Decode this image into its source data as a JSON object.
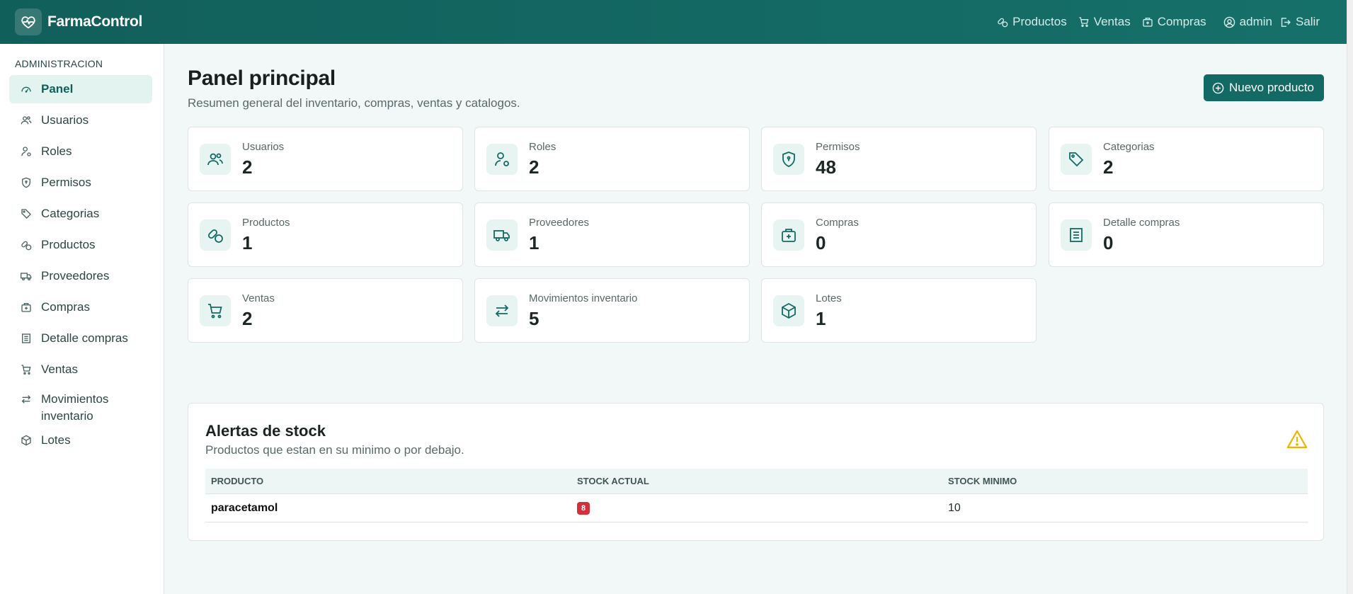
{
  "app": {
    "name": "FarmaControl",
    "logo_icon": "heart-pulse-icon"
  },
  "topnav": {
    "items": [
      {
        "label": "Productos",
        "icon": "pills-icon"
      },
      {
        "label": "Ventas",
        "icon": "cart-icon"
      },
      {
        "label": "Compras",
        "icon": "medkit-bag-icon"
      }
    ],
    "user": {
      "label": "admin",
      "icon": "user-circle-icon"
    },
    "logout": {
      "label": "Salir",
      "icon": "logout-icon"
    }
  },
  "sidebar": {
    "heading": "ADMINISTRACION",
    "items": [
      {
        "label": "Panel",
        "icon": "speedometer-icon",
        "active": true
      },
      {
        "label": "Usuarios",
        "icon": "users-icon"
      },
      {
        "label": "Roles",
        "icon": "user-gear-icon"
      },
      {
        "label": "Permisos",
        "icon": "shield-icon"
      },
      {
        "label": "Categorias",
        "icon": "tags-icon"
      },
      {
        "label": "Productos",
        "icon": "pills-icon"
      },
      {
        "label": "Proveedores",
        "icon": "truck-icon"
      },
      {
        "label": "Compras",
        "icon": "medkit-bag-icon"
      },
      {
        "label": "Detalle compras",
        "icon": "receipt-icon"
      },
      {
        "label": "Ventas",
        "icon": "cart-icon"
      },
      {
        "label": "Movimientos inventario",
        "icon": "arrows-left-right-icon"
      },
      {
        "label": "Lotes",
        "icon": "box-icon"
      }
    ]
  },
  "header": {
    "title": "Panel principal",
    "subtitle": "Resumen general del inventario, compras, ventas y catalogos.",
    "new_button": "Nuevo producto"
  },
  "stats": [
    {
      "label": "Usuarios",
      "value": "2"
    },
    {
      "label": "Roles",
      "value": "2"
    },
    {
      "label": "Permisos",
      "value": "48"
    },
    {
      "label": "Categorias",
      "value": "2"
    },
    {
      "label": "Productos",
      "value": "1"
    },
    {
      "label": "Proveedores",
      "value": "1"
    },
    {
      "label": "Compras",
      "value": "0"
    },
    {
      "label": "Detalle compras",
      "value": "0"
    },
    {
      "label": "Ventas",
      "value": "2"
    },
    {
      "label": "Movimientos inventario",
      "value": "5"
    },
    {
      "label": "Lotes",
      "value": "1"
    }
  ],
  "alerts": {
    "title": "Alertas de stock",
    "subtitle": "Productos que estan en su minimo o por debajo.",
    "columns": [
      "PRODUCTO",
      "STOCK ACTUAL",
      "STOCK MINIMO"
    ],
    "rows": [
      {
        "producto": "paracetamol",
        "stock_actual": "8",
        "stock_minimo": "10"
      }
    ]
  },
  "colors": {
    "brand": "#136a64",
    "danger": "#d2303b",
    "warning": "#f0b400"
  }
}
